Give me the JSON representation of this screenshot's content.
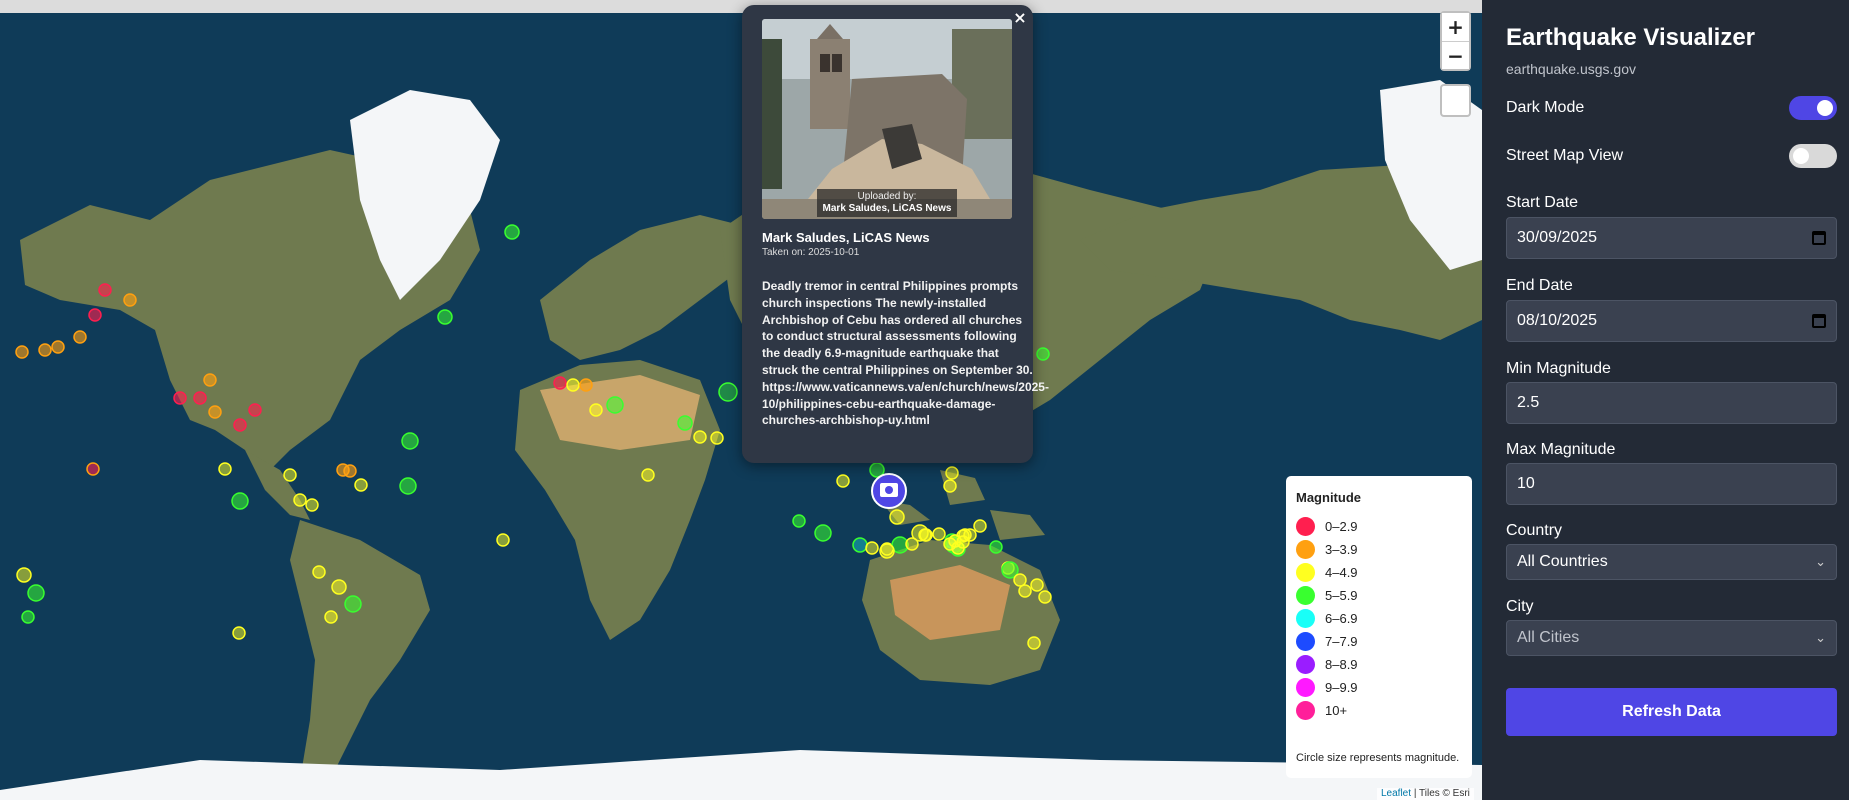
{
  "map": {
    "zoom_in": "+",
    "zoom_out": "−",
    "attribution_link": "Leaflet",
    "attribution_rest": "| Tiles © Esri"
  },
  "popup": {
    "close": "×",
    "uploaded_by_label": "Uploaded by:",
    "uploaded_by_name": "Mark Saludes, LiCAS News",
    "author": "Mark Saludes, LiCAS News",
    "taken_on": "Taken on: 2025-10-01",
    "body": "Deadly tremor in central Philippines prompts church inspections The newly-installed Archbishop of Cebu has ordered all churches to conduct structural assessments following the deadly 6.9-magnitude earthquake that struck the central Philippines on September 30. https://www.vaticannews.va/en/church/news/2025-10/philippines-cebu-earthquake-damage-churches-archbishop-uy.html"
  },
  "legend": {
    "title": "Magnitude",
    "items": [
      {
        "label": "0–2.9",
        "color": "#ff1f4f"
      },
      {
        "label": "3–3.9",
        "color": "#ffa010"
      },
      {
        "label": "4–4.9",
        "color": "#ffff20"
      },
      {
        "label": "5–5.9",
        "color": "#39ff2f"
      },
      {
        "label": "6–6.9",
        "color": "#19fff7"
      },
      {
        "label": "7–7.9",
        "color": "#1d4bff"
      },
      {
        "label": "8–8.9",
        "color": "#9a1dff"
      },
      {
        "label": "9–9.9",
        "color": "#ff19ff"
      },
      {
        "label": "10+",
        "color": "#ff1f9a"
      }
    ],
    "note": "Circle size represents magnitude."
  },
  "panel": {
    "title": "Earthquake Visualizer",
    "subtitle": "earthquake.usgs.gov",
    "dark_mode_label": "Dark Mode",
    "dark_mode_on": true,
    "street_view_label": "Street Map View",
    "street_view_on": false,
    "start_date_label": "Start Date",
    "start_date_value": "30/09/2025",
    "end_date_label": "End Date",
    "end_date_value": "08/10/2025",
    "min_mag_label": "Min Magnitude",
    "min_mag_value": "2.5",
    "max_mag_label": "Max Magnitude",
    "max_mag_value": "10",
    "country_label": "Country",
    "country_value": "All Countries",
    "city_label": "City",
    "city_value": "All Cities",
    "refresh_label": "Refresh Data",
    "accent_color": "#4f46e5"
  }
}
